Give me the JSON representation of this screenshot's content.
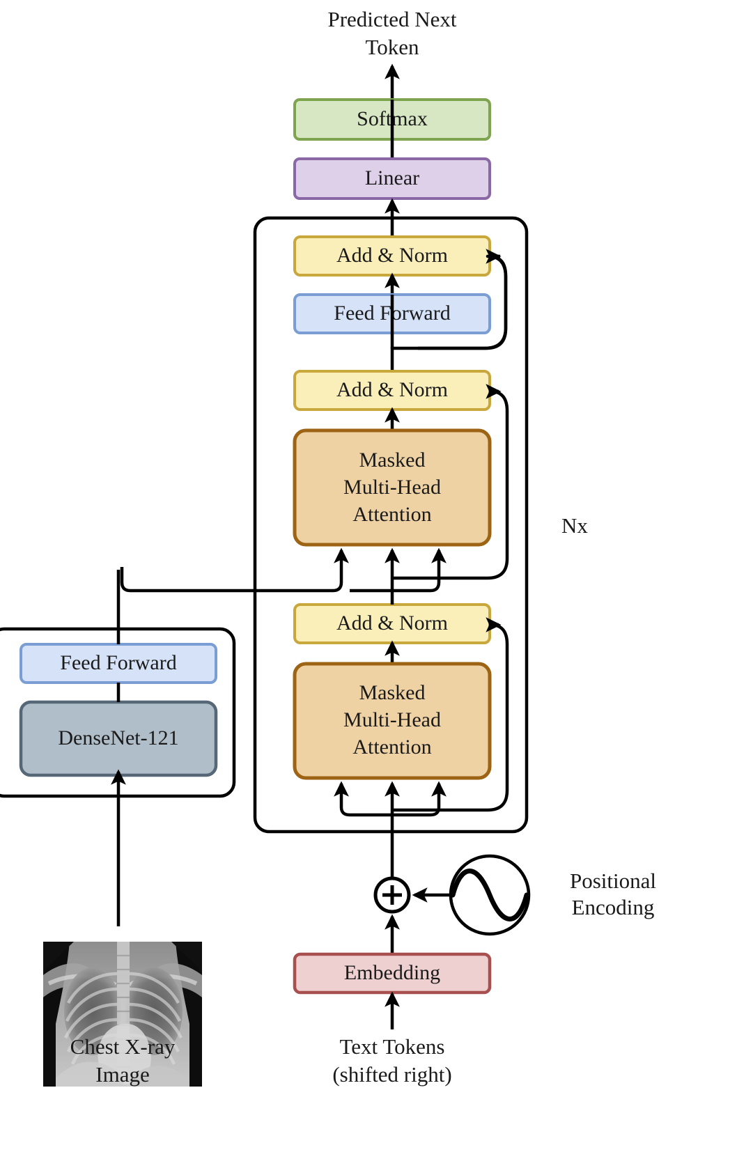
{
  "figure": {
    "title": "Multimodal encoder-decoder transformer architecture for chest X-ray report generation",
    "top_output_label": "Predicted Next\nToken",
    "top_output_line1": "Predicted Next",
    "top_output_line2": "Token",
    "repeat_label": "Nx",
    "positional_encoding_label_line1": "Positional",
    "positional_encoding_label_line2": "Encoding",
    "image_input_label_line1": "Chest X-ray",
    "image_input_label_line2": "Image",
    "text_input_label_line1": "Text Tokens",
    "text_input_label_line2": "(shifted right)",
    "add_symbol": "+"
  },
  "decoder": {
    "softmax": "Softmax",
    "linear": "Linear",
    "add_norm_top": "Add & Norm",
    "feed_forward": "Feed Forward",
    "add_norm_mid": "Add & Norm",
    "attention_top_line1": "Masked",
    "attention_top_line2": "Multi-Head",
    "attention_top_line3": "Attention",
    "add_norm_bottom": "Add & Norm",
    "attention_bottom_line1": "Masked",
    "attention_bottom_line2": "Multi-Head",
    "attention_bottom_line3": "Attention",
    "embedding": "Embedding"
  },
  "encoder": {
    "feed_forward": "Feed Forward",
    "backbone": "DenseNet-121"
  },
  "colors": {
    "softmax_fill": "#d8e7c3",
    "softmax_stroke": "#7fa450",
    "linear_fill": "#ddd0e8",
    "linear_stroke": "#8a68a6",
    "add_norm_fill": "#faeeb9",
    "add_norm_stroke": "#c8a83c",
    "feed_forward_fill": "#d5e2f7",
    "feed_forward_stroke": "#7a9ed4",
    "attention_fill": "#eed2a4",
    "attention_stroke": "#9c6414",
    "embedding_fill": "#efd0d0",
    "embedding_stroke": "#a85050",
    "densenet_fill": "#b0bec9",
    "densenet_stroke": "#566878",
    "wire": "#000000",
    "text": "#1a1a1a",
    "background": "#ffffff"
  }
}
